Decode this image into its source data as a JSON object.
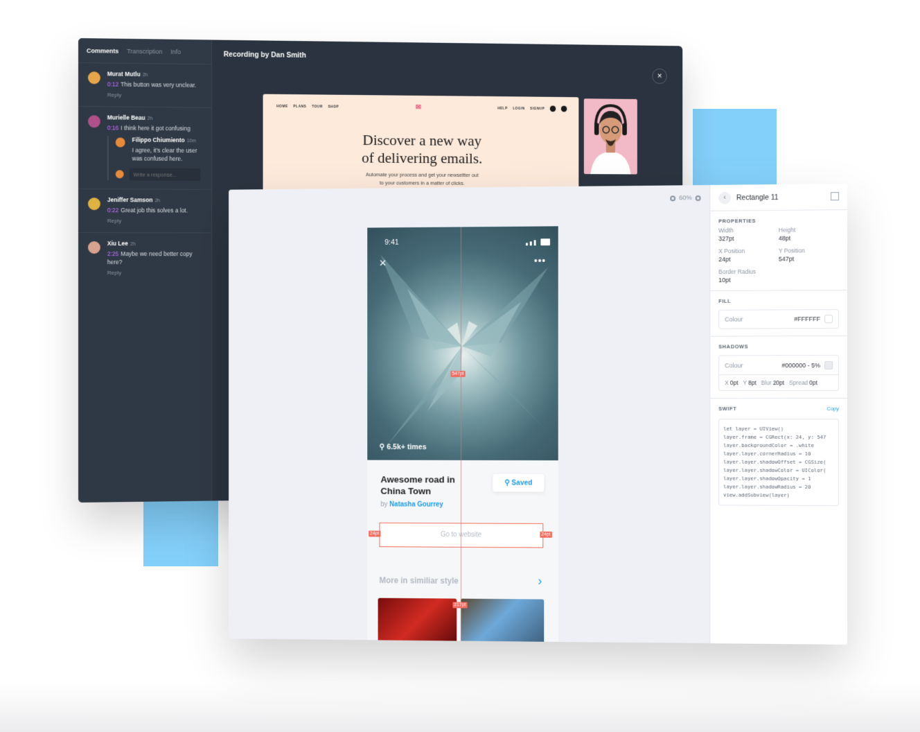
{
  "comments_panel": {
    "tabs": [
      "Comments",
      "Transcription",
      "Info"
    ],
    "items": [
      {
        "name": "Murat Mutlu",
        "time": "2h",
        "timestamp": "0:12",
        "text": "This button was very unclear.",
        "reply": "Reply",
        "avatar_color": "#e8a64a"
      },
      {
        "name": "Murielle Beau",
        "time": "2h",
        "timestamp": "0:16",
        "text": "I think here it got confusing",
        "avatar_color": "#b04f8a",
        "thread": {
          "name": "Filippo Chiumiento",
          "time": "10m",
          "text": "I agree, it's clear the user was confused here.",
          "avatar_color": "#e78a3a",
          "placeholder": "Write a response..."
        }
      },
      {
        "name": "Jeniffer Samson",
        "time": "2h",
        "timestamp": "0:22",
        "text": "Great job this solves a lot.",
        "reply": "Reply",
        "avatar_color": "#e0b240"
      },
      {
        "name": "Xiu Lee",
        "time": "2h",
        "timestamp": "2:25",
        "text": "Maybe we need better copy here?",
        "reply": "Reply",
        "avatar_color": "#d9a28e"
      }
    ]
  },
  "recording": {
    "title": "Recording by Dan Smith",
    "close_icon": "×",
    "site": {
      "nav_left": [
        "HOME",
        "PLANS",
        "TOUR",
        "SHOP"
      ],
      "nav_right": [
        "HELP",
        "LOGIN",
        "SIGNUP"
      ],
      "logo": "✉",
      "headline_1": "Discover a new way",
      "headline_2": "of delivering emails.",
      "subtitle_1": "Automate your process and get your newseltter out",
      "subtitle_2": "to your customers in a matter of clicks."
    }
  },
  "inspector": {
    "zoom": "60%",
    "phone": {
      "time": "9:41",
      "more": "•••",
      "saves": "6.5k+ times",
      "title_1": "Awesome road in",
      "title_2": "China Town",
      "by": "by",
      "author": "Natasha Gourrey",
      "saved_label": "Saved",
      "go_label": "Go to website",
      "more_label": "More in similiar style",
      "tag_y": "547pt",
      "tag_left": "24pt",
      "tag_right": "24pt",
      "tag_bottom": "217pt"
    },
    "props": {
      "title": "Rectangle 11",
      "properties_label": "PROPERTIES",
      "width_label": "Width",
      "width": "327pt",
      "height_label": "Height",
      "height": "48pt",
      "x_label": "X Position",
      "x": "24pt",
      "y_label": "Y Position",
      "y": "547pt",
      "radius_label": "Border Radius",
      "radius": "10pt",
      "fill_label": "FILL",
      "fill_colour_label": "Colour",
      "fill_colour": "#FFFFFF",
      "shadows_label": "SHADOWS",
      "shadow_colour_label": "Colour",
      "shadow_colour": "#000000 - 5%",
      "shadow_x_label": "X",
      "shadow_x": "0pt",
      "shadow_y_label": "Y",
      "shadow_y": "8pt",
      "shadow_blur_label": "Blur",
      "shadow_blur": "20pt",
      "shadow_spread_label": "Spread",
      "shadow_spread": "0pt",
      "swift_label": "SWIFT",
      "copy_label": "Copy",
      "code": "let layer = UIView()\nlayer.frame = CGRect(x: 24, y: 547\nlayer.backgroundColor = .white\nlayer.layer.cornerRadius = 10\nlayer.layer.shadowOffset = CGSize(\nlayer.layer.shadowColor = UIColor(\nlayer.layer.shadowOpacity = 1\nlayer.layer.shadowRadius = 20\nview.addSubview(layer)"
    }
  },
  "colors": {
    "accent": "#1c9bea",
    "guide": "#f26b5e",
    "timestamp": "#c073ff",
    "panel_dark": "#2a333f",
    "backdrop_blue": "#83d0fb"
  }
}
